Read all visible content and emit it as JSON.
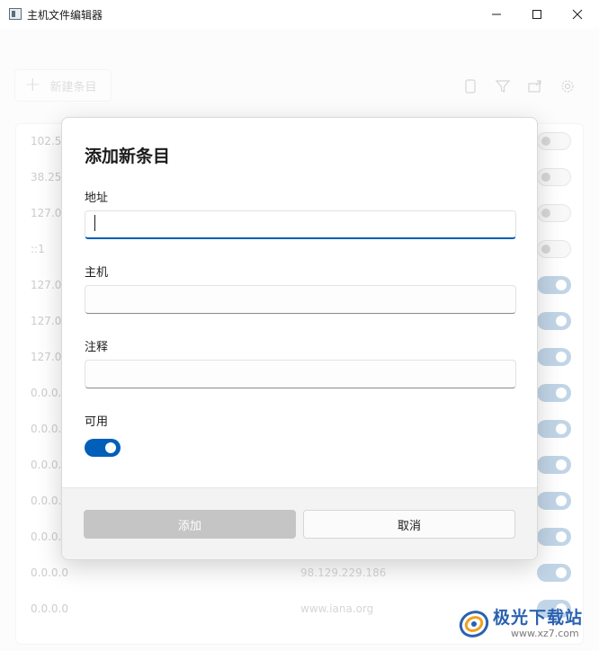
{
  "window": {
    "title": "主机文件编辑器"
  },
  "toolbar": {
    "new_entry_label": "新建条目",
    "icons": [
      "document-icon",
      "filter-icon",
      "export-icon",
      "gear-icon"
    ]
  },
  "rows": [
    {
      "addr": "102.54",
      "host": "",
      "enabled": false
    },
    {
      "addr": "38.25.",
      "host": "",
      "enabled": false
    },
    {
      "addr": "127.0.",
      "host": "",
      "enabled": false
    },
    {
      "addr": "::1",
      "host": "",
      "enabled": false
    },
    {
      "addr": "127.0.",
      "host": "",
      "enabled": true
    },
    {
      "addr": "127.0.",
      "host": "",
      "enabled": true
    },
    {
      "addr": "127.0.",
      "host": "",
      "enabled": true
    },
    {
      "addr": "0.0.0.0",
      "host": "",
      "enabled": true
    },
    {
      "addr": "0.0.0.0",
      "host": "",
      "enabled": true
    },
    {
      "addr": "0.0.0.0",
      "host": "",
      "enabled": true
    },
    {
      "addr": "0.0.0.0",
      "host": "",
      "enabled": true
    },
    {
      "addr": "0.0.0.0",
      "host": "",
      "enabled": true
    },
    {
      "addr": "0.0.0.0",
      "host": "98.129.229.186",
      "enabled": true
    },
    {
      "addr": "0.0.0.0",
      "host": "www.iana.org",
      "enabled": true
    }
  ],
  "dialog": {
    "title": "添加新条目",
    "address_label": "地址",
    "address_value": "",
    "host_label": "主机",
    "host_value": "",
    "comment_label": "注释",
    "comment_value": "",
    "enabled_label": "可用",
    "enabled": true,
    "add_button": "添加",
    "cancel_button": "取消"
  },
  "watermark": {
    "text": "极光下载站",
    "url": "www.xz7.com"
  },
  "colors": {
    "accent": "#005fb8",
    "toggle_dim": "#8fb3d3"
  }
}
